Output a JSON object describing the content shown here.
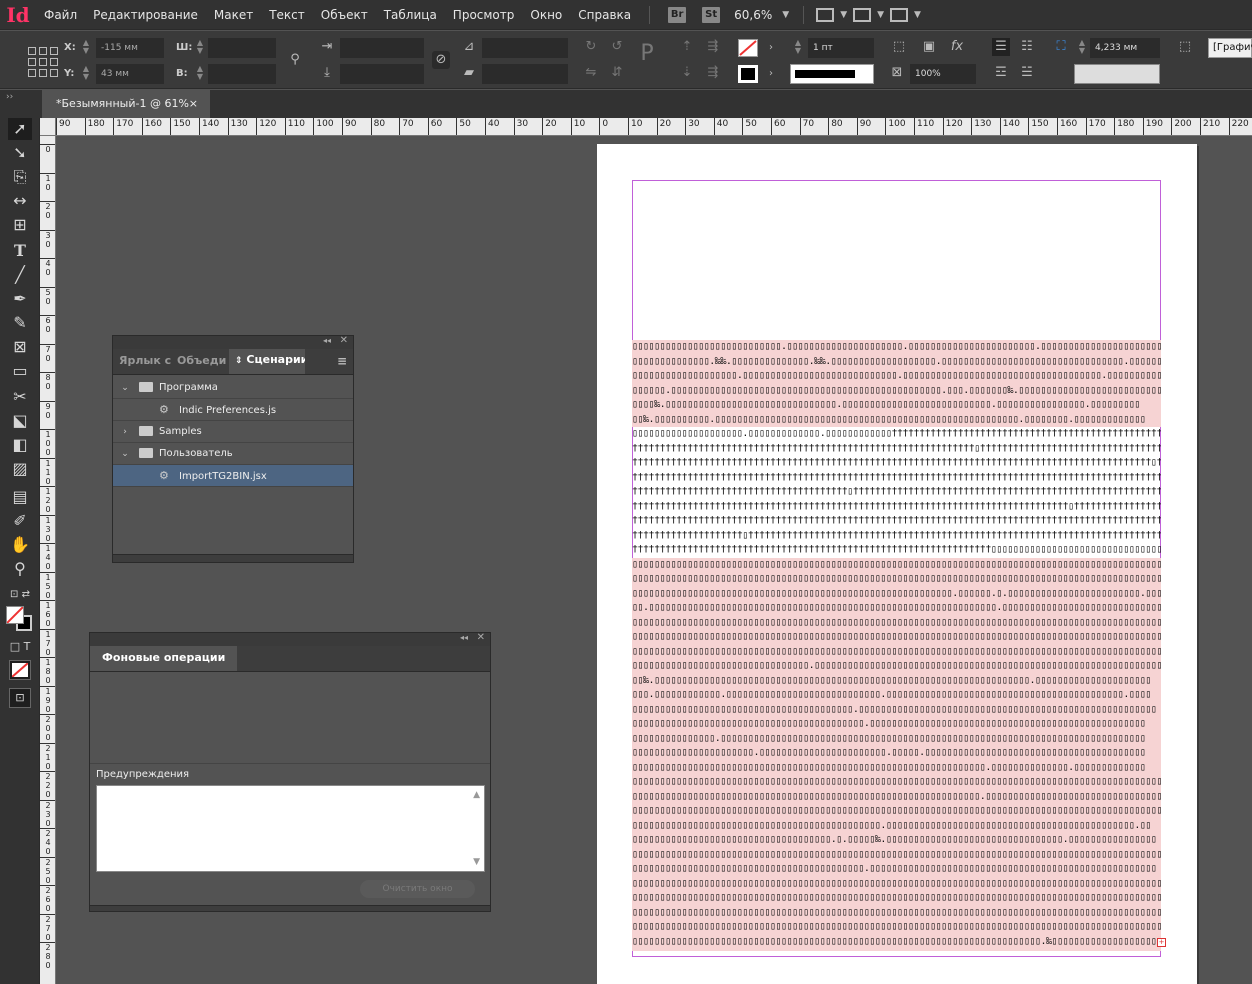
{
  "app": {
    "logo": "Id"
  },
  "menu": [
    "Файл",
    "Редактирование",
    "Макет",
    "Текст",
    "Объект",
    "Таблица",
    "Просмотр",
    "Окно",
    "Справка"
  ],
  "appbar": {
    "bridge": "Br",
    "stock": "St",
    "zoom": "60,6%"
  },
  "control": {
    "x_label": "X:",
    "x_value": "-115 мм",
    "y_label": "Y:",
    "y_value": "43 мм",
    "w_label": "Ш:",
    "h_label": "В:",
    "stroke_weight": "1 пт",
    "opacity": "100%",
    "dimension": "4,233 мм",
    "style_dropdown": "[Графический"
  },
  "document_tab": {
    "title": "*Безымянный-1 @ 61%",
    "close": "×"
  },
  "ruler": {
    "h_labels": [
      "90",
      "180",
      "170",
      "160",
      "150",
      "140",
      "130",
      "120",
      "110",
      "100",
      "90",
      "80",
      "70",
      "60",
      "50",
      "40",
      "30",
      "20",
      "10",
      "0",
      "10",
      "20",
      "30",
      "40",
      "50",
      "60",
      "70",
      "80",
      "90",
      "100",
      "110",
      "120",
      "130",
      "140",
      "150",
      "160",
      "170",
      "180",
      "190",
      "200",
      "210",
      "220"
    ],
    "v_labels": [
      "0",
      "1 0",
      "2 0",
      "3 0",
      "4 0",
      "5 0",
      "6 0",
      "7 0",
      "8 0",
      "9 0",
      "1 0 0",
      "1 1 0",
      "1 2 0",
      "1 3 0",
      "1 4 0",
      "1 5 0",
      "1 6 0",
      "1 7 0",
      "1 8 0",
      "1 9 0",
      "2 0 0",
      "2 1 0",
      "2 2 0",
      "2 3 0",
      "2 4 0",
      "2 5 0",
      "2 6 0",
      "2 7 0",
      "2 8 0"
    ]
  },
  "scripts_panel": {
    "tabs": [
      "Ярлык с",
      "Объеди",
      "Сценарии"
    ],
    "items": [
      {
        "label": "Программа",
        "type": "folder",
        "expanded": true,
        "level": 0
      },
      {
        "label": "Indic Preferences.js",
        "type": "script",
        "level": 1
      },
      {
        "label": "Samples",
        "type": "folder",
        "expanded": false,
        "level": 0
      },
      {
        "label": "Пользователь",
        "type": "folder",
        "expanded": true,
        "level": 0
      },
      {
        "label": "ImportTG2BIN.jsx",
        "type": "script",
        "level": 1,
        "selected": true
      }
    ]
  },
  "background_panel": {
    "tab": "Фоновые операции",
    "warnings_label": "Предупреждения",
    "clear_button": "Очистить окно"
  },
  "colors": {
    "accent_selection": "#4d6582",
    "frame_margin": "#c060d8",
    "text_highlight": "#f6d3d3"
  },
  "text_frame": {
    "lines": [
      "▯▯▯▯▯▯▯▯▯▯▯▯▯▯▯▯▯▯▯▯▯▯▯▯▯▯▯.▯▯▯▯▯▯▯▯▯▯▯▯▯▯▯▯▯▯▯▯▯.▯▯▯▯▯▯▯▯▯▯▯▯▯▯▯▯▯▯▯▯▯▯▯.▯▯▯▯▯▯▯▯▯▯▯▯▯▯▯▯▯▯▯▯▯▯▯▯",
      "▯▯▯▯▯▯▯▯▯▯▯▯▯▯.‰‰.▯▯▯▯▯▯▯▯▯▯▯▯▯▯.‰‰.▯▯▯▯▯▯▯▯▯▯▯▯▯▯▯▯▯▯▯.▯▯▯▯▯▯▯▯▯▯▯▯▯▯▯▯▯▯▯▯▯▯▯▯▯▯▯▯▯▯▯▯▯.▯▯▯▯▯▯▯▯▯",
      "▯▯▯▯▯▯▯▯▯▯▯▯▯▯▯▯▯▯▯.▯▯▯▯▯▯▯▯▯▯▯▯▯▯▯▯▯▯▯▯▯▯▯▯▯▯▯▯.▯▯▯▯▯▯▯▯▯▯▯▯▯▯▯▯▯▯▯▯▯▯▯▯▯▯▯▯▯▯▯▯▯▯▯▯.▯▯▯▯▯▯▯▯▯▯▯▯▯",
      "▯▯▯▯▯▯.▯▯▯▯▯▯▯▯▯▯▯▯▯▯▯▯▯▯▯▯▯▯▯▯▯▯▯▯▯▯▯▯▯▯▯▯▯▯▯▯▯▯▯▯▯▯▯▯▯.▯▯▯.▯▯▯▯▯▯▯‰.▯▯▯▯▯▯▯▯▯▯▯▯▯▯▯▯▯▯▯▯▯▯▯▯▯▯",
      "▯▯▯▯‰.▯▯▯▯▯▯▯▯▯▯▯▯▯▯▯▯▯▯▯▯▯▯▯▯▯▯▯▯▯▯▯.▯▯▯▯▯▯▯▯▯▯▯▯▯▯▯▯▯▯▯▯▯▯▯▯▯▯▯.▯▯▯▯▯▯▯▯▯▯▯▯▯▯▯▯.▯▯▯▯▯▯▯▯▯",
      "▯▯‰.▯▯▯▯▯▯▯▯▯▯.▯▯▯▯▯▯▯▯▯▯▯▯▯▯▯▯▯▯▯▯▯▯▯▯▯▯▯▯▯▯▯▯▯▯▯▯▯▯▯▯▯▯▯▯▯▯▯▯▯▯▯▯▯▯▯.▯▯▯▯▯▯▯▯.▯▯▯▯▯▯▯▯▯▯▯▯▯",
      "▯▯▯▯▯▯▯▯▯▯▯▯▯▯▯▯▯▯▯▯.▯▯▯▯▯▯▯▯▯▯▯▯▯.▯▯▯▯▯▯▯▯▯▯▯▯††††††††††††††††††††††††††††††††††††††††††††††††††",
      "††††††††††††††††††††††††††††††††††††††††††††††††††††††††††††††▯†††††††††††††††††††††††††††††††††††††",
      "††††††††††††††††††††††††††††††††††††††††††††††††††††††††††††††††††††††††††††††††††††††††††††††▯††",
      "††††††††††††††††††††††††††††††††††††††††††††††††††††††††††††††††††††††††††††††††††††††††††††††††††",
      "†††††††††††††††††††††††††††††††††††††††▯††††††††††††††††††††††††††††††††††††††††††††††††††††††††",
      "†††††††††††††††††††††††††††††††††††††††††††††††††††††††††††††††††††††††††††††††▯††††††††††††††††††",
      "††††††††††††††††††††††††††††††††††††††††††††††††††††††††††††††††††††††††††††††††††††††††††††††††††",
      "††††††††††††††††††††▯†††††††††††††††††††††††††††††††††††††††††††††††††††††††††††††††††††††††††††",
      "†††††††††††††††††††††††††††††††††††††††††††††††††††††††††††††††††▯▯▯▯▯▯▯▯▯▯▯▯▯▯▯▯▯▯▯▯▯▯▯▯▯▯▯▯▯▯▯▯▯▯▯",
      "▯▯▯▯▯▯▯▯▯▯▯▯▯▯▯▯▯▯▯▯▯▯▯▯▯▯▯▯▯▯▯▯▯▯▯▯▯▯▯▯▯▯▯▯▯▯▯▯▯▯▯▯▯▯▯▯▯▯▯▯▯▯▯▯▯▯▯▯▯▯▯▯▯▯▯▯▯▯▯▯▯▯▯▯▯▯▯▯▯▯▯▯▯▯▯▯▯▯",
      "▯▯▯▯▯▯▯▯▯▯▯▯▯▯▯▯▯▯▯▯▯▯▯▯▯▯▯▯▯▯▯▯▯▯▯▯▯▯▯▯▯▯▯▯▯▯▯▯▯▯▯▯▯▯▯▯▯▯▯▯▯▯▯▯▯▯▯▯▯▯▯▯▯▯▯▯▯▯▯▯▯▯▯▯▯▯▯▯▯▯▯▯▯▯▯▯▯▯",
      "▯▯▯▯▯▯▯▯▯▯▯▯▯▯▯▯▯▯▯▯▯▯▯▯▯▯▯▯▯▯▯▯▯▯▯▯▯▯▯▯▯▯▯▯▯▯▯▯▯▯▯▯▯▯▯▯▯▯.▯▯▯▯▯▯.▯.▯▯▯▯▯▯▯▯▯▯▯▯▯▯▯▯▯▯▯▯▯▯▯▯.▯▯▯",
      "▯▯.▯▯▯▯▯▯▯▯▯▯▯▯▯▯▯▯▯▯▯▯▯▯▯▯▯▯▯▯▯▯▯▯▯▯▯▯▯▯▯▯▯▯▯▯▯▯▯▯▯▯▯▯▯▯▯▯▯▯▯▯▯▯▯.▯▯▯▯▯▯▯▯▯▯▯▯▯▯▯▯▯▯▯▯▯▯▯▯▯▯▯▯▯▯",
      "▯▯▯▯▯▯▯▯▯▯▯▯▯▯▯▯▯▯▯▯▯▯▯▯▯▯▯▯▯▯▯▯▯▯▯▯▯▯▯▯▯▯▯▯▯▯▯▯▯▯▯▯▯▯▯▯▯▯▯▯▯▯▯▯▯▯▯▯▯▯▯▯▯▯▯▯▯▯▯▯▯▯▯▯▯▯▯▯▯▯▯▯▯▯▯▯▯▯",
      "▯▯▯▯▯▯▯▯▯▯▯▯▯▯▯▯▯▯▯▯▯▯▯▯▯▯▯▯▯▯▯▯▯▯▯▯▯▯▯▯▯▯▯▯▯▯▯▯▯▯▯▯▯▯▯▯▯▯▯▯▯▯▯▯▯▯▯▯▯▯▯▯▯▯▯▯▯▯▯▯▯▯▯▯▯▯▯▯▯▯▯▯▯▯▯▯▯▯",
      "▯▯▯▯▯▯▯▯▯▯▯▯▯▯▯▯▯▯▯▯▯▯▯▯▯▯▯▯▯▯▯▯▯▯▯▯▯▯▯▯▯▯▯▯▯▯▯▯▯▯▯▯▯▯▯▯▯▯▯▯▯▯▯▯▯▯▯▯▯▯▯▯▯▯▯▯▯▯▯▯▯▯▯▯▯▯▯▯▯▯▯▯▯▯▯▯▯▯",
      "▯▯▯▯▯▯▯▯▯▯▯▯▯▯▯▯▯▯▯▯▯▯▯▯▯▯▯▯▯▯▯▯.▯▯▯▯▯▯▯▯▯▯▯▯▯▯▯▯▯▯▯▯▯▯▯▯▯▯▯▯▯▯▯▯▯▯▯▯▯▯▯▯▯▯▯▯▯▯▯▯▯▯▯▯▯▯▯▯▯▯▯▯▯▯▯▯",
      "▯▯‰.▯▯▯▯▯▯▯▯▯▯▯▯▯▯▯▯▯▯▯▯▯▯▯▯▯▯▯▯▯▯▯▯▯▯▯▯▯▯▯▯▯▯▯▯▯▯▯▯▯▯▯▯▯▯▯▯▯▯▯▯▯▯▯▯▯▯▯▯.▯▯▯▯▯▯▯▯▯▯▯▯▯▯▯▯▯▯▯▯▯",
      "▯▯▯.▯▯▯▯▯▯▯▯▯▯▯▯.▯▯▯▯▯▯▯▯▯▯▯▯▯▯▯▯▯▯▯▯▯▯▯▯▯▯▯▯.▯▯▯▯▯▯▯▯▯▯▯▯▯▯▯▯▯▯▯▯▯▯▯▯▯▯▯▯▯▯▯▯▯▯▯▯▯▯▯▯▯▯▯.▯▯▯▯",
      "▯▯▯▯▯▯▯▯▯▯▯▯▯▯▯▯▯▯▯▯▯▯▯▯▯▯▯▯▯▯▯▯▯▯▯▯▯▯▯▯.▯▯▯▯▯▯▯▯▯▯▯▯▯▯▯▯▯▯▯▯▯▯▯▯▯▯▯▯▯▯▯▯▯▯▯▯▯▯▯▯▯▯▯▯▯▯▯▯▯▯▯▯▯▯",
      "▯▯▯▯▯▯▯▯▯▯▯▯▯▯▯▯▯▯▯▯▯▯▯▯▯▯▯▯▯▯▯▯▯▯▯▯▯▯▯▯▯▯.▯▯▯▯▯▯▯▯▯▯▯▯▯▯▯▯▯▯▯▯▯▯▯▯▯▯▯▯▯▯▯▯▯▯▯▯▯▯▯▯▯▯▯▯▯▯▯▯▯▯",
      "▯▯▯▯▯▯▯▯▯▯▯▯▯▯▯.▯▯▯▯▯▯▯▯▯▯▯▯▯▯▯▯▯▯▯▯▯▯▯▯▯▯▯▯▯▯▯▯▯▯▯▯▯▯▯▯▯▯▯▯▯▯▯▯▯▯▯▯▯▯▯▯▯▯▯▯▯▯▯▯▯▯▯▯▯▯▯▯▯▯▯▯▯",
      "▯▯▯▯▯▯▯▯▯▯▯▯▯▯▯▯▯▯▯▯▯▯.▯▯▯▯▯▯▯▯▯▯▯▯▯▯▯▯▯▯▯▯▯▯▯.▯▯▯▯▯.▯▯▯▯▯▯▯▯▯▯▯▯▯▯▯▯▯▯▯▯▯▯▯▯▯▯▯▯▯▯▯▯▯▯▯▯▯▯▯▯",
      "▯▯▯▯▯▯▯▯▯▯▯▯▯▯▯▯▯▯▯▯▯▯▯▯▯▯▯▯▯▯▯▯▯▯▯▯▯▯▯▯▯▯▯▯▯▯▯▯▯▯▯▯▯▯▯▯▯▯▯▯▯▯▯▯.▯▯▯▯▯▯▯▯▯▯▯▯▯▯.▯▯▯▯▯▯▯▯▯▯▯▯▯",
      "▯▯▯▯▯▯▯▯▯▯▯▯▯▯▯▯▯▯▯▯▯▯▯▯▯▯▯▯▯▯▯▯▯▯▯▯▯▯▯▯▯▯▯▯▯▯▯▯▯▯▯▯▯▯▯▯▯▯▯▯▯▯▯▯▯▯▯▯▯▯▯▯▯▯▯▯▯▯▯▯▯▯▯▯▯▯▯▯▯▯▯▯▯▯▯▯▯▯",
      "▯▯▯▯▯▯▯▯▯▯▯▯▯▯▯▯▯▯▯▯▯▯▯▯▯▯▯▯▯▯▯▯▯▯▯▯▯▯▯▯▯▯▯▯▯▯▯▯▯▯▯▯▯▯▯▯▯▯▯▯▯▯▯.▯▯▯▯▯▯▯▯▯▯▯▯▯▯▯▯▯▯▯▯▯▯▯▯▯▯▯▯▯▯▯▯",
      "▯▯▯▯▯▯▯▯▯▯▯▯▯▯▯▯▯▯▯▯▯▯▯▯▯▯▯▯▯▯▯▯▯▯▯▯▯▯▯▯▯▯▯▯▯▯▯▯▯▯▯▯▯▯▯▯▯▯▯▯▯▯▯▯▯▯▯▯▯▯▯▯▯▯▯▯▯▯▯▯▯▯▯▯▯▯▯▯▯▯▯▯▯▯▯▯▯▯",
      "▯▯▯▯▯▯▯▯▯▯▯▯▯▯▯▯▯▯▯▯▯▯▯▯▯▯▯▯▯▯▯▯▯▯▯▯▯▯▯▯▯▯▯▯▯.▯▯▯▯▯▯▯▯▯▯▯▯▯▯▯▯▯▯▯▯▯▯▯▯▯▯▯▯▯▯▯▯▯▯▯▯▯▯▯▯▯▯▯▯▯.▯▯",
      "▯▯▯▯▯▯▯▯▯▯▯▯▯▯▯▯▯▯▯▯▯▯▯▯▯▯▯▯▯▯▯▯▯▯▯▯.▯.▯▯▯▯▯‰.▯▯▯▯▯▯▯▯▯▯▯▯▯▯▯▯▯▯▯▯▯▯▯▯▯▯▯▯▯▯▯▯.▯▯▯▯▯▯▯▯▯▯▯▯▯▯▯▯",
      "▯▯▯▯▯▯▯▯▯▯▯▯▯▯▯▯▯▯▯▯▯▯▯▯▯▯▯▯▯▯▯▯▯▯▯▯▯▯▯▯▯▯▯▯▯▯▯▯▯▯▯▯▯▯▯▯▯▯▯▯▯▯▯▯▯▯▯▯▯▯▯▯▯▯▯▯▯▯▯▯▯▯▯▯▯▯▯▯▯▯▯▯▯▯▯▯▯▯",
      "▯▯▯▯▯▯▯▯▯▯▯▯▯▯▯▯▯▯▯▯▯▯▯▯▯▯▯▯▯▯▯▯▯▯▯▯▯▯▯▯▯▯.▯▯▯▯▯▯▯▯▯▯▯▯▯▯▯▯▯▯▯▯▯▯▯▯▯▯▯▯▯▯▯▯▯▯▯▯▯▯▯▯▯▯▯▯▯▯▯▯▯▯▯▯",
      "▯▯▯▯▯▯▯▯▯▯▯▯▯▯▯▯▯▯▯▯▯▯▯▯▯▯▯▯▯▯▯▯▯▯▯▯▯▯▯▯▯▯▯▯▯▯▯▯▯▯▯▯▯▯▯▯▯▯▯▯▯▯▯▯▯▯▯▯▯▯▯▯▯▯▯▯▯▯▯▯▯▯▯▯▯▯▯▯▯▯▯▯▯▯▯▯▯▯",
      "▯▯▯▯▯▯▯▯▯▯▯▯▯▯▯▯▯▯▯▯▯▯▯▯▯▯▯▯▯▯▯▯▯▯▯▯▯▯▯▯▯▯▯▯▯▯▯▯▯▯▯▯▯▯▯▯▯▯▯▯▯▯▯▯▯▯▯▯▯▯▯▯▯▯▯▯▯▯▯▯▯▯▯▯▯▯▯▯▯▯▯▯▯▯▯▯▯▯",
      "▯▯▯▯▯▯▯▯▯▯▯▯▯▯▯▯▯▯▯▯▯▯▯▯▯▯▯▯▯▯▯▯▯▯▯▯▯▯▯▯▯▯▯▯▯▯▯▯▯▯▯▯▯▯▯▯▯▯▯▯▯▯▯▯▯▯▯▯▯▯▯▯▯▯▯▯▯▯▯▯▯▯▯▯▯▯▯▯▯▯▯▯▯▯▯▯▯▯",
      "▯▯▯▯▯▯▯▯▯▯▯▯▯▯▯▯▯▯▯▯▯▯▯▯▯▯▯▯▯▯▯▯▯▯▯▯▯▯▯▯▯▯▯▯▯▯▯▯▯▯▯▯▯▯▯▯▯▯▯▯▯▯▯▯▯▯▯▯▯▯▯▯▯▯▯▯▯▯▯▯▯▯▯▯▯▯▯▯▯▯▯▯▯▯▯▯▯▯",
      "▯▯▯▯▯▯▯▯▯▯▯▯▯▯▯▯▯▯▯▯▯▯▯▯▯▯▯▯▯▯▯▯▯▯▯▯▯▯▯▯▯▯▯▯▯▯▯▯▯▯▯▯▯▯▯▯▯▯▯▯▯▯▯▯▯▯▯▯▯▯▯▯▯▯.‰▯▯▯▯▯▯▯▯▯▯▯▯▯▯▯▯▯▯▯",
      "▯▯▯▯▯▯▯▯▯▯▯▯▯▯▯▯▯▯▯▯▯▯▯▯▯▯▯.▯▯▯▯▯▯▯▯▯▯▯▯▯▯▯▯▯▯▯▯▯▯▯▯▯▯▯▯▯▯▯▯▯▯▯▯▯▯▯▯▯▯▯▯▯▯▯▯▯▯▯▯▯▯▯▯▯▯▯▯▯▯▯▯▯▯▯▯"
    ],
    "overset_marker": "+"
  }
}
